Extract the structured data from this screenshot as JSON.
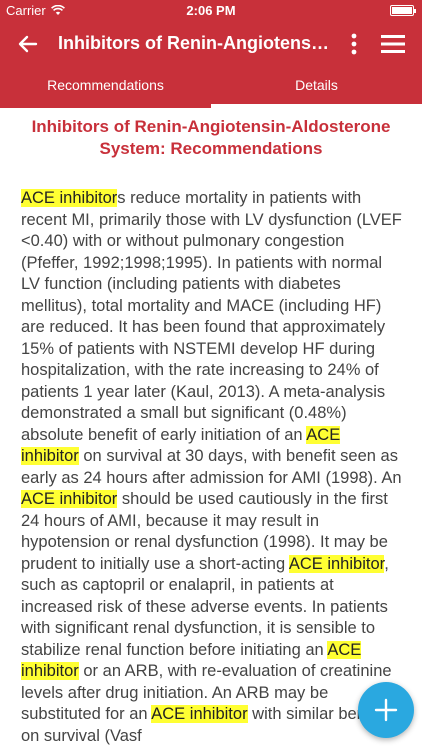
{
  "status_bar": {
    "carrier": "Carrier",
    "time": "2:06 PM"
  },
  "app_bar": {
    "title": "Inhibitors of Renin-Angiotensin..."
  },
  "tabs": [
    {
      "label": "Recommendations",
      "active": false
    },
    {
      "label": "Details",
      "active": true
    }
  ],
  "content": {
    "heading": "Inhibitors of Renin-Angiotensin-Aldosterone System: Recommendations",
    "paragraph": [
      {
        "text": "ACE inhibitor",
        "highlight": true
      },
      {
        "text": "s reduce mortality in patients with recent MI, primarily those with LV dysfunction (LVEF <0.40) with or without pulmonary congestion (Pfeffer, 1992;1998;1995). In patients with normal LV function (including patients with diabetes mellitus), total mortality and MACE (including HF) are reduced. It has been found that approximately 15% of patients with NSTEMI develop HF during hospitalization, with the rate increasing to 24% of patients 1 year later (Kaul, 2013). A meta-analysis demonstrated a small but significant (0.48%) absolute benefit of early initiation of an ",
        "highlight": false
      },
      {
        "text": "ACE inhibitor",
        "highlight": true
      },
      {
        "text": " on survival at 30 days, with benefit seen as early as 24 hours after admission for AMI (1998). An ",
        "highlight": false
      },
      {
        "text": "ACE inhibitor",
        "highlight": true
      },
      {
        "text": " should be used cautiously in the first 24 hours of AMI, because it may result in hypotension or renal dysfunction (1998). It may be prudent to initially use a short-acting ",
        "highlight": false
      },
      {
        "text": "ACE inhibitor",
        "highlight": true
      },
      {
        "text": ", such as captopril or enalapril, in patients at increased risk of these adverse events. In patients with significant renal dysfunction, it is sensible to stabilize renal function before initiating an ",
        "highlight": false
      },
      {
        "text": "ACE inhibitor",
        "highlight": true
      },
      {
        "text": " or an ARB, with re-evaluation of creatinine levels after drug initiation. An ARB may be substituted for an ",
        "highlight": false
      },
      {
        "text": "ACE inhibitor",
        "highlight": true
      },
      {
        "text": " with similar benefits on survival (Vasf",
        "highlight": false
      }
    ]
  },
  "fab": {
    "icon": "plus-icon"
  },
  "colors": {
    "brand": "#c8303a",
    "fab": "#2aa8e0",
    "highlight": "#ffff33"
  }
}
